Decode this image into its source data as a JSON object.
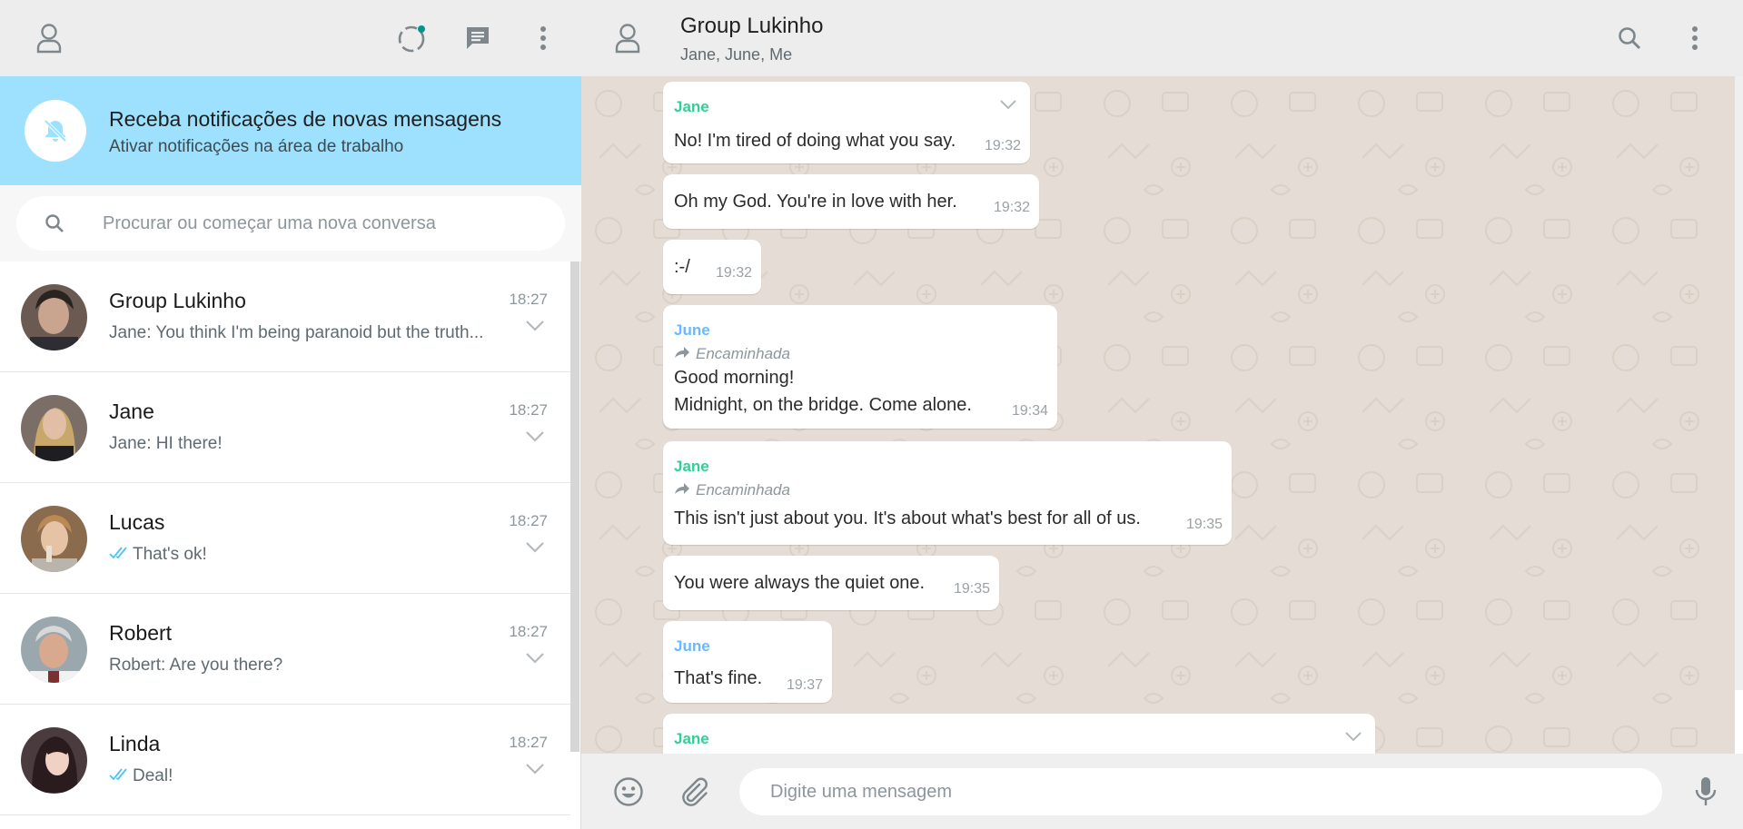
{
  "left_header": {
    "profile_icon": "person-outline-icon",
    "status_icon": "status-ring-icon",
    "new_chat_icon": "chat-bubble-icon",
    "menu_icon": "vertical-dots-icon"
  },
  "notification": {
    "title": "Receba notificações de novas mensagens",
    "subtitle": "Ativar notificações na área de trabalho",
    "icon": "bell-off-icon"
  },
  "search": {
    "placeholder": "Procurar ou começar uma nova conversa"
  },
  "chats": [
    {
      "name": "Group Lukinho",
      "time": "18:27",
      "preview": "Jane: You think I'm being paranoid but the truth...",
      "read_ticks": false
    },
    {
      "name": "Jane",
      "time": "18:27",
      "preview": "Jane: HI there!",
      "read_ticks": false
    },
    {
      "name": "Lucas",
      "time": "18:27",
      "preview": "That's ok!",
      "read_ticks": true
    },
    {
      "name": "Robert",
      "time": "18:27",
      "preview": "Robert: Are you there?",
      "read_ticks": false
    },
    {
      "name": "Linda",
      "time": "18:27",
      "preview": "Deal!",
      "read_ticks": true
    }
  ],
  "conversation": {
    "title": "Group Lukinho",
    "members": "Jane, June, Me",
    "messages": [
      {
        "sender": "Jane",
        "lines": [
          "No! I'm tired of doing what you say."
        ],
        "time": "19:32"
      },
      {
        "sender": "",
        "lines": [
          "Oh my God. You're in love with her."
        ],
        "time": "19:32"
      },
      {
        "sender": "",
        "lines": [
          ":-/"
        ],
        "time": "19:32"
      },
      {
        "sender": "June",
        "forwarded": "Encaminhada",
        "lines": [
          "Good morning!",
          "Midnight, on the bridge. Come alone."
        ],
        "time": "19:34"
      },
      {
        "sender": "Jane",
        "forwarded": "Encaminhada",
        "lines": [
          "This isn't just about you. It's about what's best for all of us."
        ],
        "time": "19:35"
      },
      {
        "sender": "",
        "lines": [
          "You were always the quiet one."
        ],
        "time": "19:35"
      },
      {
        "sender": "June",
        "lines": [
          "That's fine."
        ],
        "time": "19:37"
      },
      {
        "sender": "Jane",
        "lines": [],
        "time": ""
      }
    ]
  },
  "composer": {
    "placeholder": "Digite uma mensagem",
    "emoji_icon": "emoji-icon",
    "attach_icon": "paperclip-icon",
    "mic_icon": "microphone-icon"
  },
  "colors": {
    "jane": "#35cd96",
    "june": "#6bb8ff",
    "ticks": "#4fc3f7",
    "notification_bg": "#9de1fe",
    "chat_bg": "#e5ddd5"
  }
}
